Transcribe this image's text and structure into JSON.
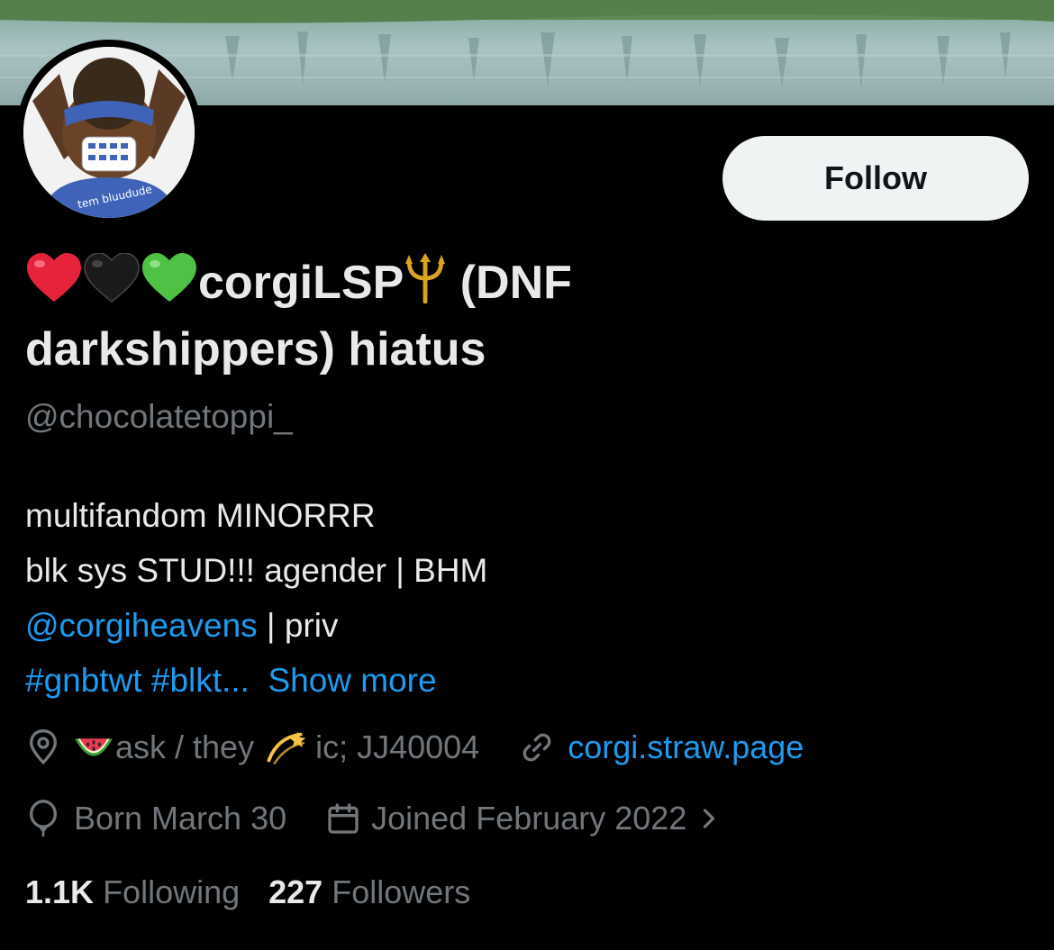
{
  "profile": {
    "name_emojis": [
      "red-heart",
      "black-heart",
      "green-heart"
    ],
    "name_part1": "corgiLSP",
    "name_part2": "(DNF",
    "name_line2": "darkshippers) hiatus",
    "handle": "@chocolatetoppi_",
    "avatar_text": "tem bluudude"
  },
  "follow_button": {
    "label": "Follow"
  },
  "bio": {
    "line1": "multifandom MINORRR",
    "line2": "blk sys STUD!!! agender | BHM",
    "line3_link": "@corgiheavens",
    "line3_rest": " | priv",
    "line4_tags": "#gnbtwt #blkt...",
    "show_more": "Show more"
  },
  "meta": {
    "location_part1": "ask / they",
    "location_part2": "ic; JJ40004",
    "website": "corgi.straw.page",
    "birthday": "Born March 30",
    "joined": "Joined February 2022"
  },
  "stats": {
    "following_count": "1.1K",
    "following_label": "Following",
    "followers_count": "227",
    "followers_label": "Followers"
  },
  "colors": {
    "background": "#000000",
    "primary_text": "#e7e9ea",
    "secondary_text": "#71767b",
    "link": "#1d9bf0",
    "follow_button_bg": "#eff3f4"
  }
}
